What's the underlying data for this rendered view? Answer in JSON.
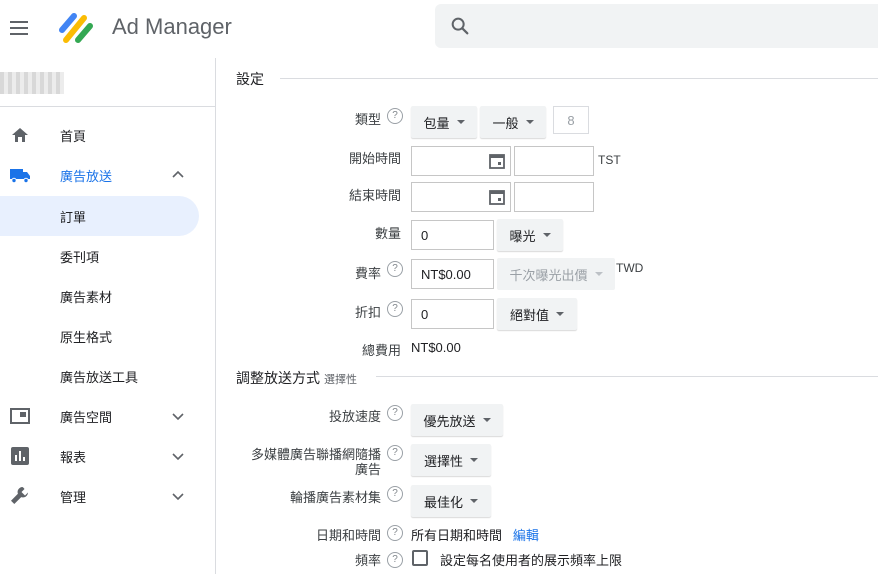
{
  "app": {
    "title": "Ad Manager",
    "search_placeholder": ""
  },
  "icons": {
    "menu": "menu-icon",
    "logo": "ad-manager-logo",
    "search": "search-icon"
  },
  "sidebar": {
    "items": [
      {
        "label": "首頁",
        "icon": "home-icon"
      },
      {
        "label": "廣告放送",
        "icon": "truck-icon",
        "expanded": true
      },
      {
        "label": "訂單",
        "selected": true
      },
      {
        "label": "委刊項"
      },
      {
        "label": "廣告素材"
      },
      {
        "label": "原生格式"
      },
      {
        "label": "廣告放送工具"
      },
      {
        "label": "廣告空間",
        "icon": "inventory-icon"
      },
      {
        "label": "報表",
        "icon": "bar-chart-icon"
      },
      {
        "label": "管理",
        "icon": "wrench-icon"
      }
    ]
  },
  "settings": {
    "section_title": "設定",
    "type": {
      "label": "類型",
      "buy_type": "包量",
      "priority_type": "一般",
      "priority_value": "8"
    },
    "start": {
      "label": "開始時間",
      "date": "",
      "time": "",
      "timezone": "TST"
    },
    "end": {
      "label": "結束時間",
      "date": "",
      "time": ""
    },
    "quantity": {
      "label": "數量",
      "value": "0",
      "unit": "曝光"
    },
    "rate": {
      "label": "費率",
      "value": "NT$0.00",
      "model": "千次曝光出價",
      "currency": "TWD"
    },
    "discount": {
      "label": "折扣",
      "value": "0",
      "type": "絕對值"
    },
    "total": {
      "label": "總費用",
      "value": "NT$0.00"
    }
  },
  "delivery": {
    "section_title": "調整放送方式",
    "optional": "選擇性",
    "pacing": {
      "label": "投放速度",
      "value": "優先放送"
    },
    "rich_media": {
      "label_line1": "多媒體廣告聯播網隨播",
      "label_line2": "廣告",
      "value": "選擇性"
    },
    "rotation": {
      "label": "輪播廣告素材集",
      "value": "最佳化"
    },
    "dayparting": {
      "label": "日期和時間",
      "value": "所有日期和時間",
      "edit": "編輯"
    },
    "frequency": {
      "label": "頻率",
      "checkbox_label": "設定每名使用者的展示頻率上限",
      "checked": false
    }
  },
  "colors": {
    "accent": "#1a73e8",
    "selected_bg": "#e8f0fe",
    "logo_blue": "#4285f4",
    "logo_yellow": "#fbbc04",
    "logo_green": "#34a853"
  }
}
